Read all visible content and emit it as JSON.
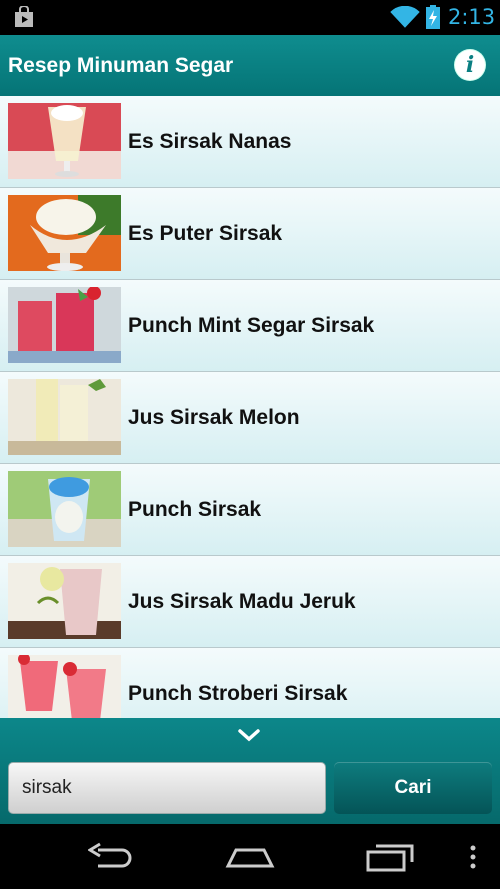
{
  "status_bar": {
    "time": "2:13",
    "icons": [
      "store-icon",
      "wifi-icon",
      "battery-charging-icon"
    ]
  },
  "action_bar": {
    "title": "Resep Minuman Segar",
    "info_glyph": "i"
  },
  "recipes": [
    {
      "name": "Es Sirsak Nanas"
    },
    {
      "name": "Es Puter Sirsak"
    },
    {
      "name": "Punch Mint Segar Sirsak"
    },
    {
      "name": "Jus Sirsak Melon"
    },
    {
      "name": "Punch Sirsak"
    },
    {
      "name": "Jus Sirsak Madu Jeruk"
    },
    {
      "name": "Punch Stroberi Sirsak"
    }
  ],
  "search": {
    "value": "sirsak",
    "button_label": "Cari"
  },
  "nav": [
    "back-icon",
    "home-icon",
    "recent-apps-icon",
    "overflow-menu-icon"
  ],
  "colors": {
    "primary": "#0a7f82",
    "status_accent": "#33b5e5"
  }
}
